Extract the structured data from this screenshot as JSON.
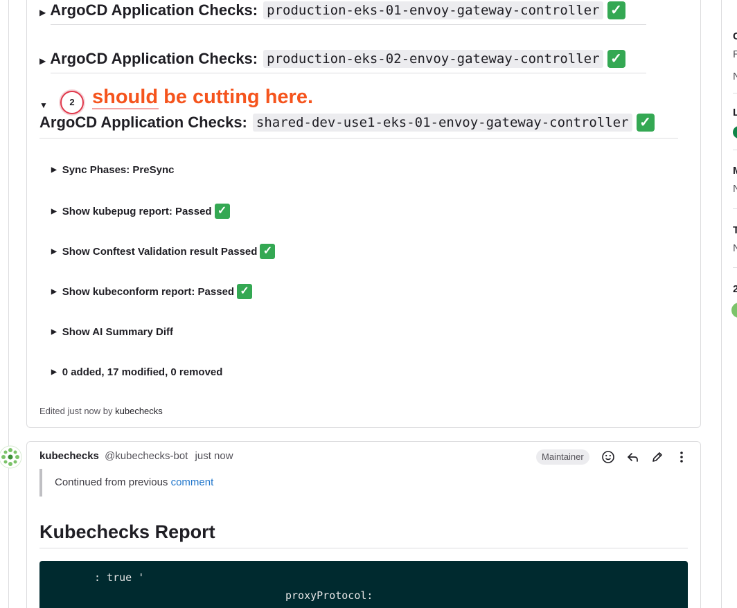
{
  "app_checks": [
    {
      "heading": "ArgoCD Application Checks:",
      "app": "production-eks-01-envoy-gateway-controller",
      "status_icon": "check-mark-button-icon"
    },
    {
      "heading": "ArgoCD Application Checks:",
      "app": "production-eks-02-envoy-gateway-controller",
      "status_icon": "check-mark-button-icon"
    },
    {
      "heading": "ArgoCD Application Checks:",
      "app": "shared-dev-use1-eks-01-envoy-gateway-controller",
      "status_icon": "check-mark-button-icon"
    }
  ],
  "annotation": {
    "number": "2",
    "text": "should be cutting here.",
    "color": "#f5541d"
  },
  "details": [
    {
      "label": "Sync Phases: PreSync",
      "check": false
    },
    {
      "label": "Show kubepug report: Passed",
      "check": true
    },
    {
      "label": "Show Conftest Validation result Passed",
      "check": true
    },
    {
      "label": "Show kubeconform report: Passed",
      "check": true
    },
    {
      "label": "Show AI Summary Diff",
      "check": false
    },
    {
      "label": "0 added, 17 modified, 0 removed",
      "check": false
    }
  ],
  "edited": {
    "prefix": "Edited just now by",
    "user": "kubechecks"
  },
  "comment": {
    "author_name": "kubechecks",
    "author_handle": "@kubechecks-bot",
    "time": "just now",
    "role_badge": "Maintainer",
    "quote_prefix": "Continued from previous",
    "quote_link": "comment",
    "report_title": "Kubechecks Report",
    "code_lines": [
      ": true '",
      "proxyProtocol:"
    ]
  },
  "sidebar_letters": [
    "C",
    "R",
    "N",
    "L",
    "M",
    "N",
    "T",
    "N",
    "2"
  ],
  "colors": {
    "accent_link": "#1f75cb",
    "success": "#34a853",
    "code_bg": "#002a2f",
    "annotation": "#f5541d"
  }
}
